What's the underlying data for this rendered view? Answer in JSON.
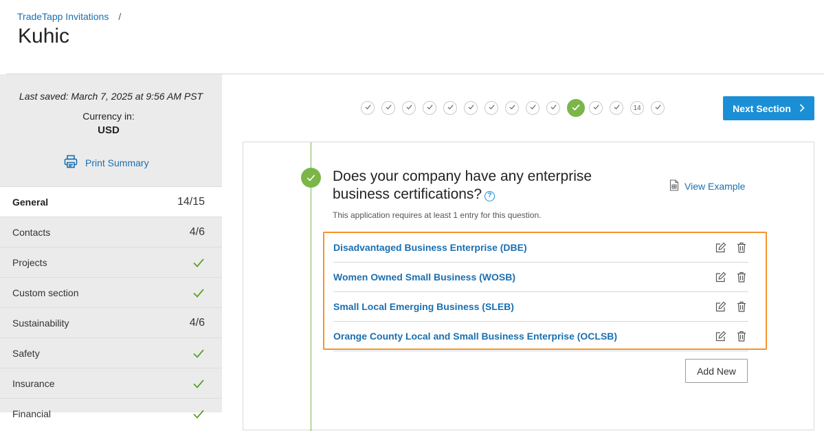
{
  "breadcrumb": {
    "parent": "TradeTapp Invitations",
    "separator": "/"
  },
  "page_title": "Kuhic",
  "sidebar": {
    "last_saved": "Last saved: March 7, 2025 at 9:56 AM PST",
    "currency_label": "Currency in:",
    "currency_value": "USD",
    "print_label": "Print Summary",
    "items": [
      {
        "label": "General",
        "count": "14/15",
        "active": true
      },
      {
        "label": "Contacts",
        "count": "4/6"
      },
      {
        "label": "Projects",
        "complete": true
      },
      {
        "label": "Custom section",
        "complete": true
      },
      {
        "label": "Sustainability",
        "count": "4/6"
      },
      {
        "label": "Safety",
        "complete": true
      },
      {
        "label": "Insurance",
        "complete": true
      },
      {
        "label": "Financial",
        "complete": true
      }
    ]
  },
  "stepper": {
    "steps": [
      "check",
      "check",
      "check",
      "check",
      "check",
      "check",
      "check",
      "check",
      "check",
      "check",
      "current",
      "check",
      "check",
      "14",
      "check"
    ],
    "current_index": 10,
    "numbered_label": "14"
  },
  "next_button": {
    "label": "Next Section"
  },
  "question": {
    "text": "Does your company have any enterprise business certifications?",
    "help_symbol": "?",
    "view_example_label": "View Example",
    "requirement": "This application requires at least 1 entry for this question."
  },
  "entries": [
    {
      "name": "Disadvantaged Business Enterprise (DBE)"
    },
    {
      "name": "Women Owned Small Business (WOSB)"
    },
    {
      "name": "Small Local Emerging Business (SLEB)"
    },
    {
      "name": "Orange County Local and Small Business Enterprise (OCLSB)"
    }
  ],
  "add_new_label": "Add New",
  "colors": {
    "accent_blue": "#1a8fd6",
    "link_blue": "#1a6fb0",
    "success_green": "#7ab648",
    "highlight_orange": "#f5922a"
  }
}
